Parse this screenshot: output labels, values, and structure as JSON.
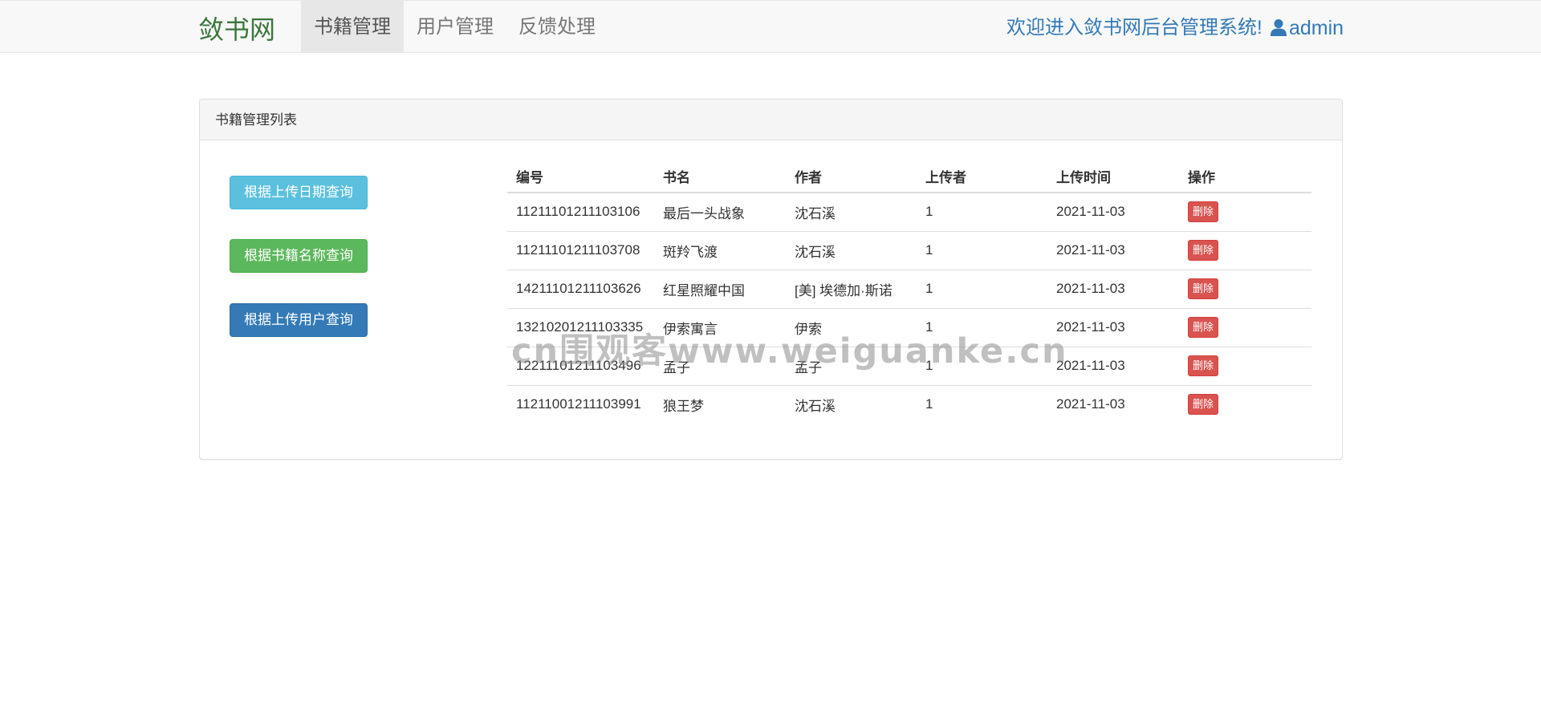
{
  "navbar": {
    "brand": "敛书网",
    "items": [
      {
        "label": "书籍管理",
        "active": true
      },
      {
        "label": "用户管理",
        "active": false
      },
      {
        "label": "反馈处理",
        "active": false
      }
    ],
    "welcome": "欢迎进入敛书网后台管理系统!",
    "user": "admin",
    "user_icon": "user-icon"
  },
  "panel": {
    "title": "书籍管理列表"
  },
  "buttons": {
    "by_date": "根据上传日期查询",
    "by_name": "根据书籍名称查询",
    "by_user": "根据上传用户查询"
  },
  "table": {
    "headers": [
      "编号",
      "书名",
      "作者",
      "上传者",
      "上传时间",
      "操作"
    ],
    "rows": [
      {
        "id": "11211101211103106",
        "name": "最后一头战象",
        "author": "沈石溪",
        "uploader": "1",
        "time": "2021-11-03",
        "action": "删除"
      },
      {
        "id": "11211101211103708",
        "name": "斑羚飞渡",
        "author": "沈石溪",
        "uploader": "1",
        "time": "2021-11-03",
        "action": "删除"
      },
      {
        "id": "14211101211103626",
        "name": "红星照耀中国",
        "author": "[美] 埃德加·斯诺",
        "uploader": "1",
        "time": "2021-11-03",
        "action": "删除"
      },
      {
        "id": "13210201211103335",
        "name": "伊索寓言",
        "author": "伊索",
        "uploader": "1",
        "time": "2021-11-03",
        "action": "删除"
      },
      {
        "id": "12211101211103496",
        "name": "孟子",
        "author": "孟子",
        "uploader": "1",
        "time": "2021-11-03",
        "action": "删除"
      },
      {
        "id": "11211001211103991",
        "name": "狼王梦",
        "author": "沈石溪",
        "uploader": "1",
        "time": "2021-11-03",
        "action": "删除"
      }
    ]
  },
  "watermark": "cn围观客www.weiguanke.cn",
  "colors": {
    "brand": "#3c763d",
    "link": "#337ab7",
    "info": "#5bc0de",
    "success": "#5cb85c",
    "primary": "#337ab7",
    "danger": "#d9534f"
  }
}
